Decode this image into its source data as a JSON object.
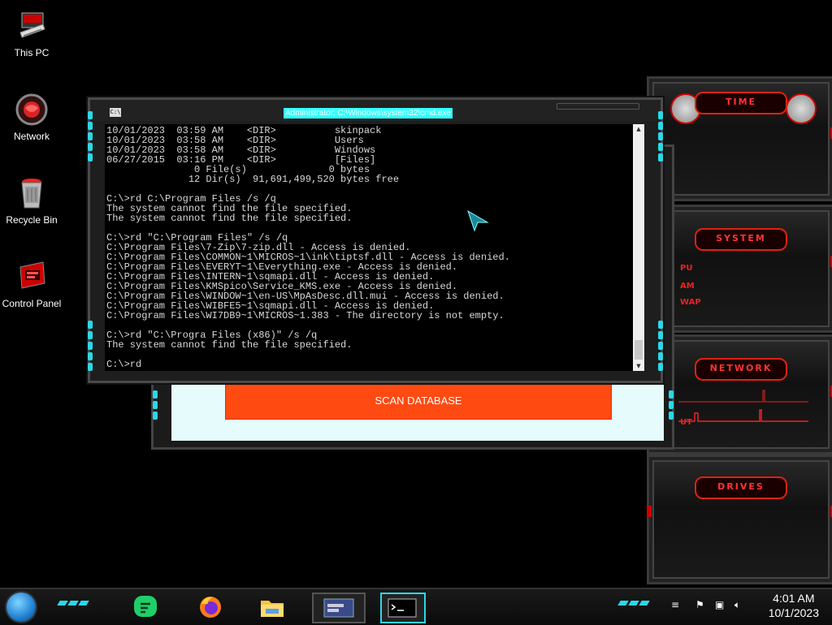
{
  "desktop": {
    "icons": [
      {
        "label": "This PC"
      },
      {
        "label": "Network"
      },
      {
        "label": "Recycle Bin"
      },
      {
        "label": "Control Panel"
      }
    ]
  },
  "cmd": {
    "title": "Administrator: C:\\Windows\\system32\\cmd.exe",
    "icon_text": "C:\\",
    "lines": [
      "10/01/2023  03:59 AM    <DIR>          skinpack",
      "10/01/2023  03:58 AM    <DIR>          Users",
      "10/01/2023  03:58 AM    <DIR>          Windows",
      "06/27/2015  03:16 PM    <DIR>          [Files]",
      "               0 File(s)              0 bytes",
      "              12 Dir(s)  91,691,499,520 bytes free",
      "",
      "C:\\>rd C:\\Program Files /s /q",
      "The system cannot find the file specified.",
      "The system cannot find the file specified.",
      "",
      "C:\\>rd \"C:\\Program Files\" /s /q",
      "C:\\Program Files\\7-Zip\\7-zip.dll - Access is denied.",
      "C:\\Program Files\\COMMON~1\\MICROS~1\\ink\\tiptsf.dll - Access is denied.",
      "C:\\Program Files\\EVERYT~1\\Everything.exe - Access is denied.",
      "C:\\Program Files\\INTERN~1\\sqmapi.dll - Access is denied.",
      "C:\\Program Files\\KMSpico\\Service_KMS.exe - Access is denied.",
      "C:\\Program Files\\WINDOW~1\\en-US\\MpAsDesc.dll.mui - Access is denied.",
      "C:\\Program Files\\WIBFE5~1\\sqmapi.dll - Access is denied.",
      "C:\\Program Files\\WI7DB9~1\\MICROS~1.383 - The directory is not empty.",
      "",
      "C:\\>rd \"C:\\Progra Files (x86)\" /s /q",
      "The system cannot find the file specified.",
      "",
      "C:\\>rd"
    ]
  },
  "scanner": {
    "button_label": "SCAN DATABASE"
  },
  "gadgets": {
    "time": {
      "header": "TIME"
    },
    "system": {
      "header": "SYSTEM",
      "labels": [
        "PU",
        "AM",
        "WAP"
      ]
    },
    "network": {
      "header": "NETWORK",
      "labels": [
        "UT"
      ]
    },
    "drives": {
      "header": "DRIVES"
    }
  },
  "taskbar": {
    "apps": [
      "start-orb",
      "chat-app",
      "firefox",
      "file-explorer",
      "window-app",
      "command-prompt"
    ],
    "clock": {
      "time": "4:01 AM",
      "date": "10/1/2023"
    }
  },
  "colors": {
    "accent_cyan": "#2ad8e8",
    "accent_red": "#e02020",
    "scan_button": "#ff4a12",
    "scanner_bg": "#e6fbfb"
  }
}
